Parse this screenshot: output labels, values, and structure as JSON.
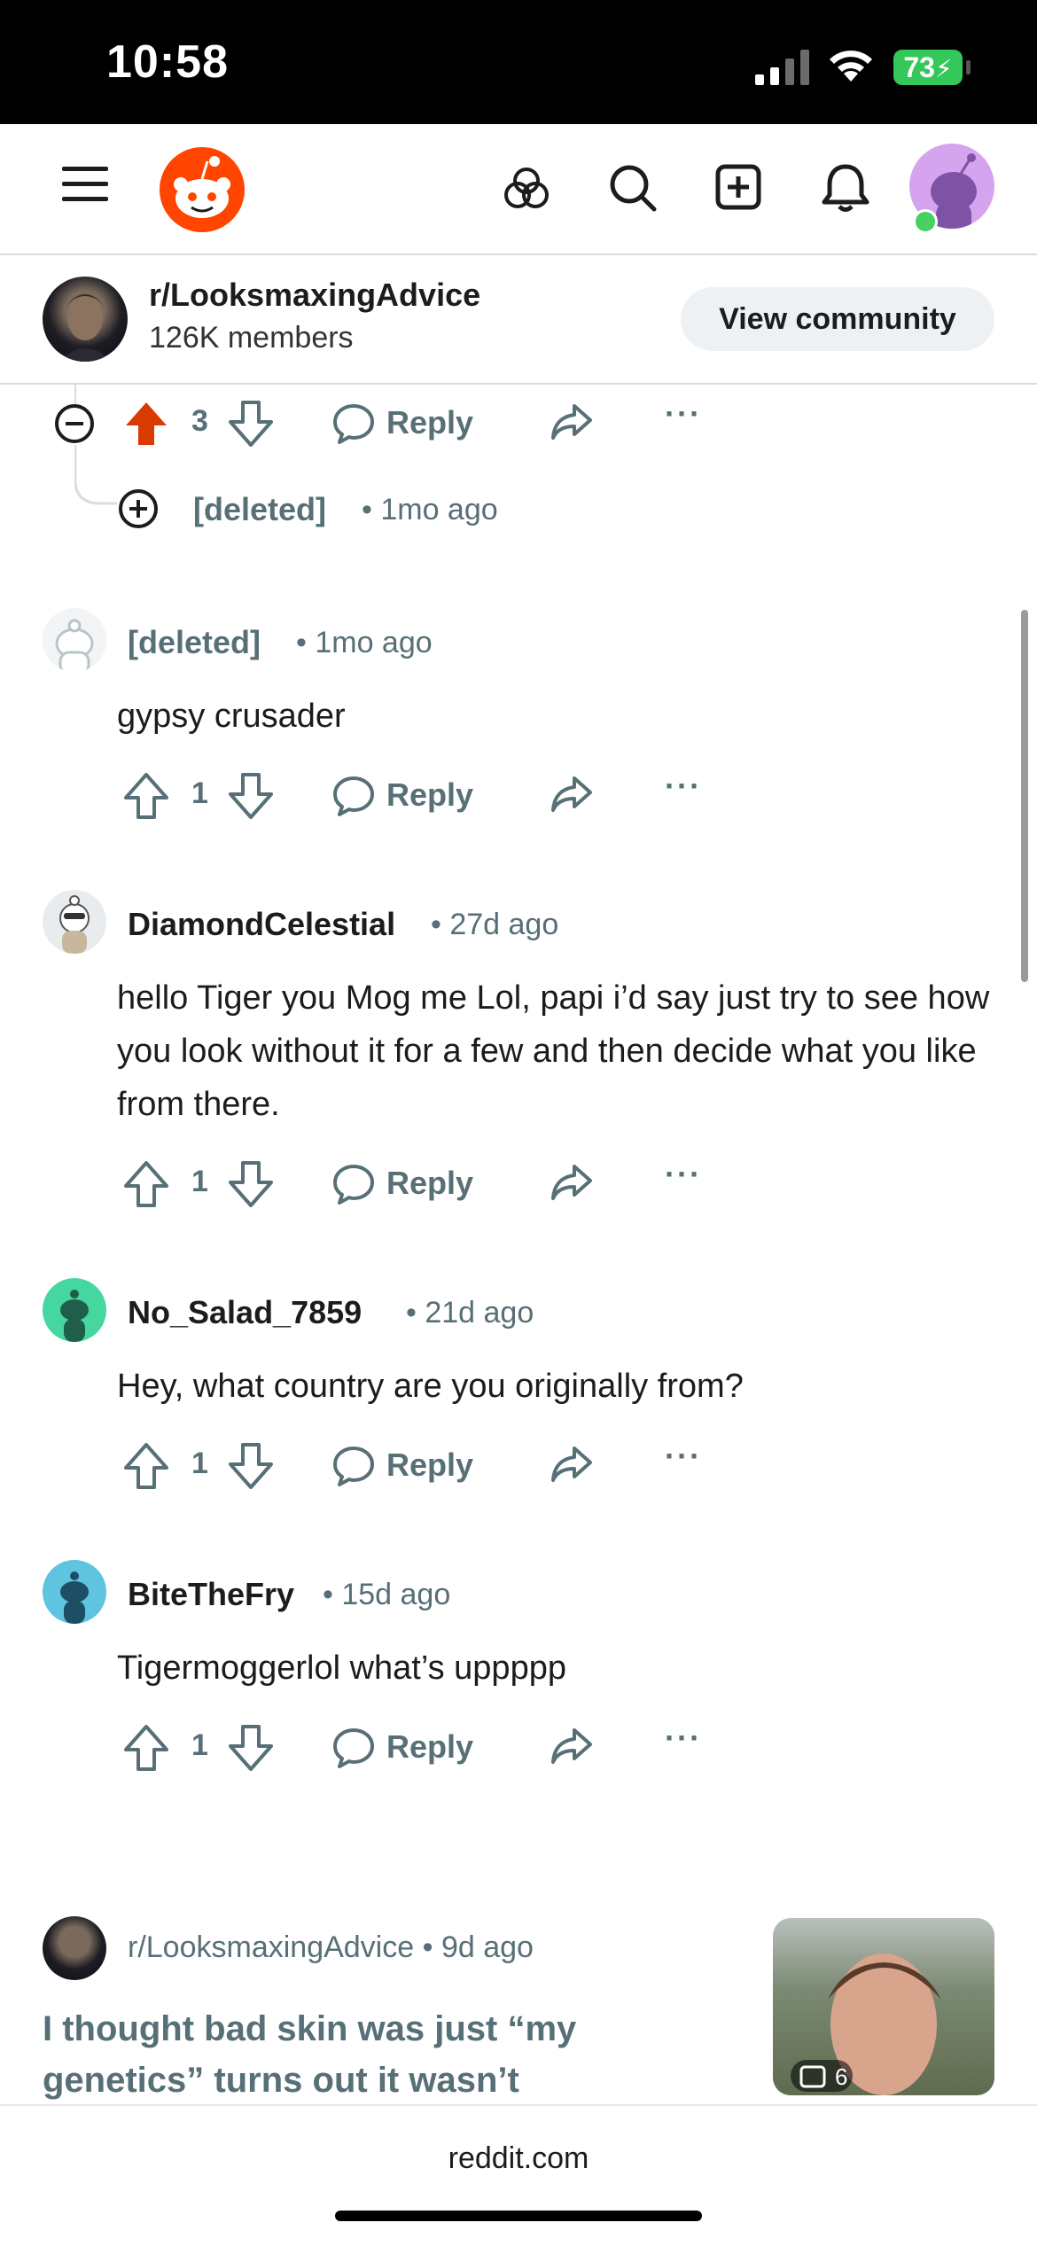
{
  "status_bar": {
    "time": "10:58",
    "battery": "73"
  },
  "nav": {
    "icons": [
      "menu-icon",
      "reddit-logo",
      "popular-icon",
      "search-icon",
      "create-post-icon",
      "notifications-icon",
      "user-avatar"
    ]
  },
  "community": {
    "name": "r/LooksmaxingAdvice",
    "members": "126K members",
    "view_button": "View community"
  },
  "top_thread": {
    "vote_count": "3",
    "reply_label": "Reply",
    "more_label": "···",
    "child": {
      "author": "[deleted]",
      "time": "• 1mo ago"
    }
  },
  "comments": [
    {
      "author": "[deleted]",
      "time": "• 1mo ago",
      "body": "gypsy crusader",
      "votes": "1",
      "reply_label": "Reply",
      "more_label": "···"
    },
    {
      "author": "DiamondCelestial",
      "time": "• 27d ago",
      "body": "hello Tiger you Mog me Lol, papi i’d say just try to see how you look without it for a few and then decide what you like from there.",
      "votes": "1",
      "reply_label": "Reply",
      "more_label": "···"
    },
    {
      "author": "No_Salad_7859",
      "time": "• 21d ago",
      "body": "Hey, what country are you originally from?",
      "votes": "1",
      "reply_label": "Reply",
      "more_label": "···"
    },
    {
      "author": "BiteTheFry",
      "time": "• 15d ago",
      "body": "Tigermoggerlol what’s uppppp",
      "votes": "1",
      "reply_label": "Reply",
      "more_label": "···"
    }
  ],
  "related_post": {
    "subreddit": "r/LooksmaxingAdvice",
    "time": "• 9d ago",
    "title": "I thought bad skin was just “my genetics” turns out it wasn’t",
    "gallery_count": "6"
  },
  "browser": {
    "url": "reddit.com"
  },
  "colors": {
    "upvote_active": "#d93a00",
    "brand": "#ff4500",
    "meta": "#576f76"
  }
}
